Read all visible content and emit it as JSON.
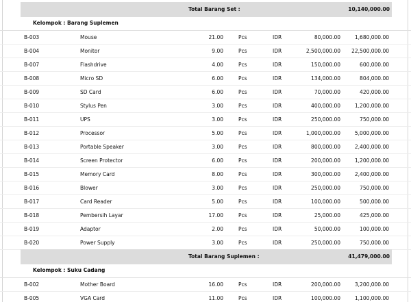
{
  "total_barang_set": {
    "label": "Total Barang Set :",
    "value": "10,140,000.00"
  },
  "groups": [
    {
      "label": "Kelompok : Barang Suplemen",
      "rows": [
        {
          "code": "B-003",
          "name": "Mouse",
          "qty": "21.00",
          "unit": "Pcs",
          "currency": "IDR",
          "price": "80,000.00",
          "total": "1,680,000.00"
        },
        {
          "code": "B-004",
          "name": "Monitor",
          "qty": "9.00",
          "unit": "Pcs",
          "currency": "IDR",
          "price": "2,500,000.00",
          "total": "22,500,000.00"
        },
        {
          "code": "B-007",
          "name": "Flashdrive",
          "qty": "4.00",
          "unit": "Pcs",
          "currency": "IDR",
          "price": "150,000.00",
          "total": "600,000.00"
        },
        {
          "code": "B-008",
          "name": "Micro SD",
          "qty": "6.00",
          "unit": "Pcs",
          "currency": "IDR",
          "price": "134,000.00",
          "total": "804,000.00"
        },
        {
          "code": "B-009",
          "name": "SD Card",
          "qty": "6.00",
          "unit": "Pcs",
          "currency": "IDR",
          "price": "70,000.00",
          "total": "420,000.00"
        },
        {
          "code": "B-010",
          "name": "Stylus Pen",
          "qty": "3.00",
          "unit": "Pcs",
          "currency": "IDR",
          "price": "400,000.00",
          "total": "1,200,000.00"
        },
        {
          "code": "B-011",
          "name": "UPS",
          "qty": "3.00",
          "unit": "Pcs",
          "currency": "IDR",
          "price": "250,000.00",
          "total": "750,000.00"
        },
        {
          "code": "B-012",
          "name": "Processor",
          "qty": "5.00",
          "unit": "Pcs",
          "currency": "IDR",
          "price": "1,000,000.00",
          "total": "5,000,000.00"
        },
        {
          "code": "B-013",
          "name": "Portable Speaker",
          "qty": "3.00",
          "unit": "Pcs",
          "currency": "IDR",
          "price": "800,000.00",
          "total": "2,400,000.00"
        },
        {
          "code": "B-014",
          "name": "Screen Protector",
          "qty": "6.00",
          "unit": "Pcs",
          "currency": "IDR",
          "price": "200,000.00",
          "total": "1,200,000.00"
        },
        {
          "code": "B-015",
          "name": "Memory Card",
          "qty": "8.00",
          "unit": "Pcs",
          "currency": "IDR",
          "price": "300,000.00",
          "total": "2,400,000.00"
        },
        {
          "code": "B-016",
          "name": "Blower",
          "qty": "3.00",
          "unit": "Pcs",
          "currency": "IDR",
          "price": "250,000.00",
          "total": "750,000.00"
        },
        {
          "code": "B-017",
          "name": "Card Reader",
          "qty": "5.00",
          "unit": "Pcs",
          "currency": "IDR",
          "price": "100,000.00",
          "total": "500,000.00"
        },
        {
          "code": "B-018",
          "name": "Pembersih Layar",
          "qty": "17.00",
          "unit": "Pcs",
          "currency": "IDR",
          "price": "25,000.00",
          "total": "425,000.00"
        },
        {
          "code": "B-019",
          "name": "Adaptor",
          "qty": "2.00",
          "unit": "Pcs",
          "currency": "IDR",
          "price": "50,000.00",
          "total": "100,000.00"
        },
        {
          "code": "B-020",
          "name": "Power Supply",
          "qty": "3.00",
          "unit": "Pcs",
          "currency": "IDR",
          "price": "250,000.00",
          "total": "750,000.00"
        }
      ],
      "total": {
        "label": "Total Barang Suplemen :",
        "value": "41,479,000.00"
      }
    },
    {
      "label": "Kelompok : Suku Cadang",
      "rows": [
        {
          "code": "B-002",
          "name": "Mother Board",
          "qty": "16.00",
          "unit": "Pcs",
          "currency": "IDR",
          "price": "200,000.00",
          "total": "3,200,000.00"
        },
        {
          "code": "B-005",
          "name": "VGA Card",
          "qty": "11.00",
          "unit": "Pcs",
          "currency": "IDR",
          "price": "100,000.00",
          "total": "1,100,000.00"
        }
      ]
    }
  ]
}
